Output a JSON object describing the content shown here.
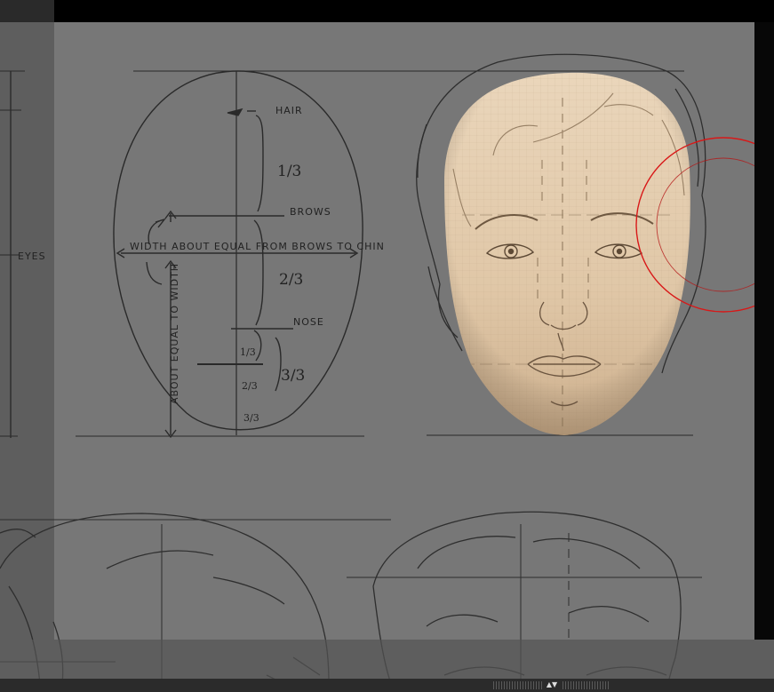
{
  "reference_sheet": {
    "label_eyes": "EYES",
    "label_hair": "HAIR",
    "label_brows": "BROWS",
    "label_nose": "NOSE",
    "label_width": "WIDTH ABOUT EQUAL FROM BROWS TO CHIN",
    "label_vertical": "ABOUT EQUAL TO WIDTH",
    "frac_upper": "1/3",
    "frac_middle": "2/3",
    "frac_lower": "3/3",
    "frac_small_1": "1/3",
    "frac_small_2": "2/3",
    "frac_small_3": "3/3"
  },
  "brush_cursor": {
    "color": "#d81818"
  },
  "sculpt_material": {
    "base_color": "#e3cdb0",
    "shade_color": "#a8886a"
  },
  "bottom_handle": {
    "icon": "expand-arrows-icon",
    "glyph": "▲▼"
  }
}
